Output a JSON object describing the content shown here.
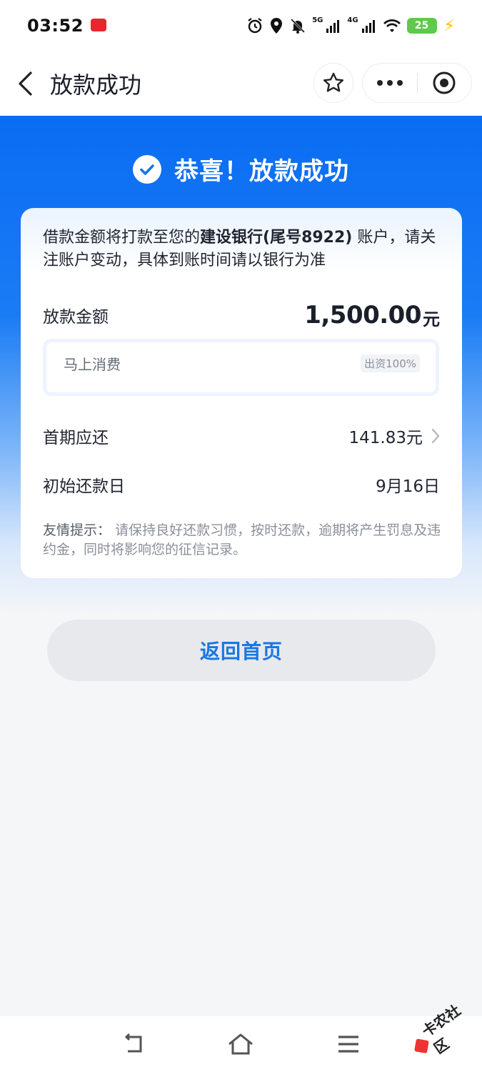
{
  "status_bar": {
    "time": "03:52",
    "signal_5g": "5G",
    "signal_4g": "4G",
    "battery": "25"
  },
  "nav": {
    "title": "放款成功"
  },
  "hero": {
    "title": "恭喜！放款成功"
  },
  "card": {
    "notice_prefix": "借款金额将打款至您的",
    "notice_bank": "建设银行(尾号8922)",
    "notice_suffix": "账户，请关注账户变动，具体到账时间请以银行为准",
    "amount_label": "放款金额",
    "amount_value": "1,500.00",
    "amount_unit": "元",
    "funder_name": "马上消费",
    "funder_share": "出资100%",
    "first_payment_label": "首期应还",
    "first_payment_value": "141.83元",
    "start_date_label": "初始还款日",
    "start_date_value": "9月16日",
    "tip_label": "友情提示：",
    "tip_text": "请保持良好还款习惯，按时还款，逾期将产生罚息及违约金，同时将影响您的征信记录。"
  },
  "actions": {
    "home_button": "返回首页"
  },
  "watermark": "卡农社区",
  "colors": {
    "primary_blue": "#0a6cf2",
    "button_text": "#1677e6"
  }
}
